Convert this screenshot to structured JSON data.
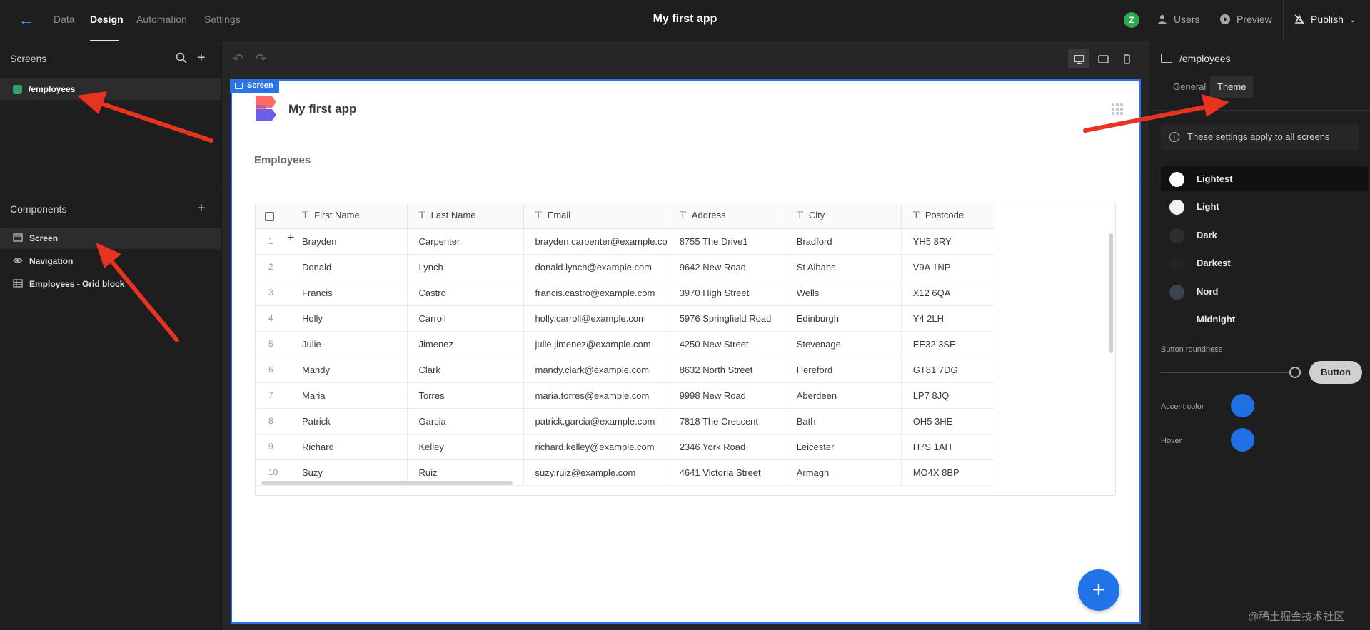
{
  "topbar": {
    "tabs": [
      {
        "label": "Data",
        "active": false
      },
      {
        "label": "Design",
        "active": true
      },
      {
        "label": "Automation",
        "active": false
      },
      {
        "label": "Settings",
        "active": false
      }
    ],
    "title": "My first app",
    "avatar_initial": "Z",
    "users_label": "Users",
    "preview_label": "Preview",
    "publish_label": "Publish"
  },
  "screens_panel": {
    "header": "Screens",
    "items": [
      {
        "label": "/employees",
        "color": "#33a06e"
      }
    ]
  },
  "components_panel": {
    "header": "Components",
    "items": [
      {
        "label": "Screen",
        "icon": "screen-icon",
        "selected": true
      },
      {
        "label": "Navigation",
        "icon": "eye-icon",
        "selected": false
      },
      {
        "label": "Employees - Grid block",
        "icon": "table-icon",
        "selected": false
      }
    ]
  },
  "canvas": {
    "badge": "Screen",
    "app_name": "My first app",
    "page_heading": "Employees",
    "table": {
      "columns": [
        "First Name",
        "Last Name",
        "Email",
        "Address",
        "City",
        "Postcode"
      ],
      "rows": [
        [
          "1",
          "Brayden",
          "Carpenter",
          "brayden.carpenter@example.co",
          "8755 The Drive1",
          "Bradford",
          "YH5 8RY"
        ],
        [
          "2",
          "Donald",
          "Lynch",
          "donald.lynch@example.com",
          "9642 New Road",
          "St Albans",
          "V9A 1NP"
        ],
        [
          "3",
          "Francis",
          "Castro",
          "francis.castro@example.com",
          "3970 High Street",
          "Wells",
          "X12 6QA"
        ],
        [
          "4",
          "Holly",
          "Carroll",
          "holly.carroll@example.com",
          "5976 Springfield Road",
          "Edinburgh",
          "Y4 2LH"
        ],
        [
          "5",
          "Julie",
          "Jimenez",
          "julie.jimenez@example.com",
          "4250 New Street",
          "Stevenage",
          "EE32 3SE"
        ],
        [
          "6",
          "Mandy",
          "Clark",
          "mandy.clark@example.com",
          "8632 North Street",
          "Hereford",
          "GT81 7DG"
        ],
        [
          "7",
          "Maria",
          "Torres",
          "maria.torres@example.com",
          "9998 New Road",
          "Aberdeen",
          "LP7 8JQ"
        ],
        [
          "8",
          "Patrick",
          "Garcia",
          "patrick.garcia@example.com",
          "7818 The Crescent",
          "Bath",
          "OH5 3HE"
        ],
        [
          "9",
          "Richard",
          "Kelley",
          "richard.kelley@example.com",
          "2346 York Road",
          "Leicester",
          "H7S 1AH"
        ],
        [
          "10",
          "Suzy",
          "Ruiz",
          "suzy.ruiz@example.com",
          "4641 Victoria Street",
          "Armagh",
          "MO4X 8BP"
        ]
      ]
    },
    "fab_label": "+"
  },
  "settings_panel": {
    "title": "/employees",
    "tabs": [
      {
        "label": "General",
        "active": false
      },
      {
        "label": "Theme",
        "active": true
      }
    ],
    "info": "These settings apply to all screens",
    "themes": [
      {
        "label": "Lightest",
        "color": "#ffffff",
        "selected": true
      },
      {
        "label": "Light",
        "color": "#f2f2f2",
        "selected": false
      },
      {
        "label": "Dark",
        "color": "#2d2d2d",
        "selected": false
      },
      {
        "label": "Darkest",
        "color": "#222222",
        "selected": false
      },
      {
        "label": "Nord",
        "color": "#3b4252",
        "selected": false
      },
      {
        "label": "Midnight",
        "color": "#1d1d22",
        "selected": false
      }
    ],
    "button_roundness_label": "Button roundness",
    "button_roundness_value": 1.0,
    "button_preview": "Button",
    "accent_color_label": "Accent color",
    "accent_color": "#1f6fe5",
    "hover_label": "Hover",
    "hover_color": "#1f6fe5"
  },
  "watermark": "@稀土掘金技术社区"
}
